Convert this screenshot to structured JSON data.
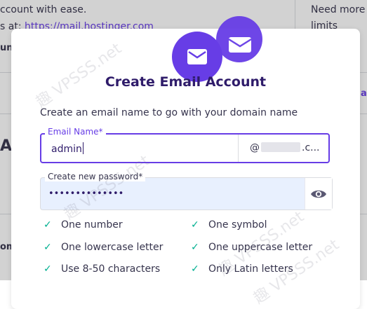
{
  "background": {
    "line1": "ccount with ease.",
    "line2_prefix": "s at: ",
    "line2_link": "https://mail.hostinger.com",
    "right_line1": "Need more",
    "right_line2": "limits",
    "left_fragment1": "unt",
    "left_fragment2": "Ac",
    "left_fragment3": "om",
    "right_fragment": "ar"
  },
  "modal": {
    "title": "Create Email Account",
    "subtitle": "Create an email name to go with your domain name",
    "email_label": "Email Name*",
    "email_value": "admin",
    "domain_prefix": "@",
    "domain_suffix": ".c...",
    "password_label": "Create new password*",
    "password_value": "••••••••••••••",
    "requirements": [
      "One number",
      "One symbol",
      "One lowercase letter",
      "One uppercase letter",
      "Use 8-50 characters",
      "Only Latin letters"
    ],
    "check_glyph": "✓"
  },
  "watermarks": [
    "趣 VPSSS.net",
    "趣 VPSSS.net",
    "趣 VPSSS.net",
    "趣 VPSSS.net"
  ],
  "colors": {
    "accent": "#673de6",
    "check": "#00b090",
    "password_bg": "#e8f0fe"
  }
}
